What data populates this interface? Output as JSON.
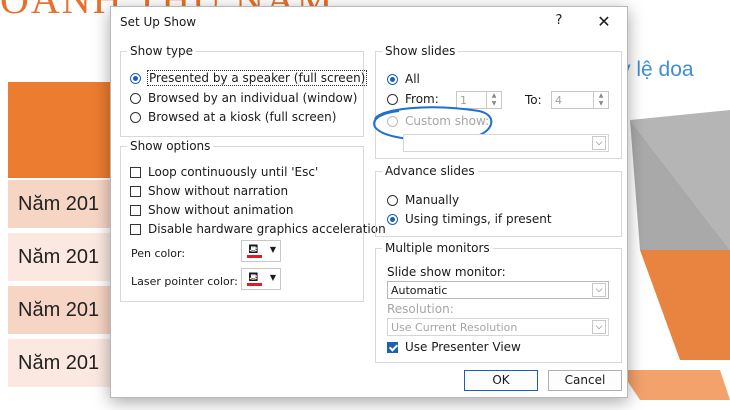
{
  "background": {
    "title": "OANH THU NĂM",
    "right_text": "ỷ lệ doa",
    "rows": [
      "Năm 201",
      "Năm 201",
      "Năm 201",
      "Năm 201"
    ]
  },
  "dialog": {
    "title": "Set Up Show",
    "help": "?",
    "close": "✕",
    "show_type": {
      "label": "Show type",
      "options": [
        "Presented by a speaker (full screen)",
        "Browsed by an individual (window)",
        "Browsed at a kiosk (full screen)"
      ],
      "selected": 0
    },
    "show_options": {
      "label": "Show options",
      "checks": [
        "Loop continuously until 'Esc'",
        "Show without narration",
        "Show without animation",
        "Disable hardware graphics acceleration"
      ],
      "pen_color_label": "Pen color:",
      "laser_color_label": "Laser pointer color:",
      "pen_color": "#e11b22",
      "laser_color": "#e11b22"
    },
    "show_slides": {
      "label": "Show slides",
      "all": "All",
      "from": "From:",
      "from_value": "1",
      "to": "To:",
      "to_value": "4",
      "custom": "Custom show:",
      "custom_value": ""
    },
    "advance_slides": {
      "label": "Advance slides",
      "manually": "Manually",
      "timings": "Using timings, if present"
    },
    "monitors": {
      "label": "Multiple monitors",
      "monitor_label": "Slide show monitor:",
      "monitor_value": "Automatic",
      "resolution_label": "Resolution:",
      "resolution_value": "Use Current Resolution",
      "presenter_view": "Use Presenter View"
    },
    "ok": "OK",
    "cancel": "Cancel"
  }
}
